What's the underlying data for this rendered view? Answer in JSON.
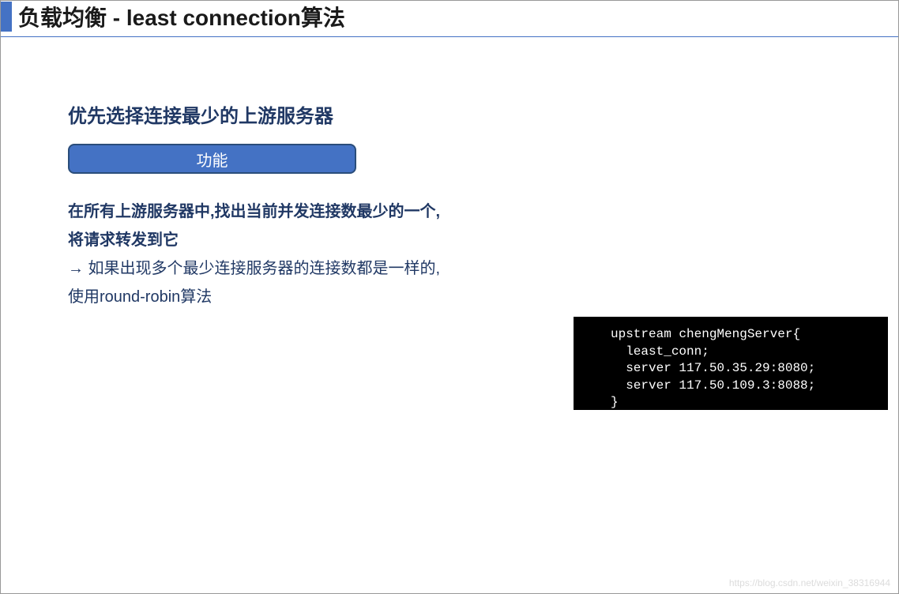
{
  "title": "负载均衡 - least connection算法",
  "subtitle": "优先选择连接最少的上游服务器",
  "badge": "功能",
  "desc_line1": "在所有上游服务器中,找出当前并发连接数最少的一个,",
  "desc_line2": "将请求转发到它",
  "arrow": "→",
  "desc_line3": " 如果出现多个最少连接服务器的连接数都是一样的,",
  "desc_line4": "使用round-robin算法",
  "code": {
    "line1": "upstream chengMengServer{",
    "line2": "  least_conn;",
    "line3": "  server 117.50.35.29:8080;",
    "line4": "  server 117.50.109.3:8088;",
    "line5": "}"
  },
  "watermark": "https://blog.csdn.net/weixin_38316944"
}
